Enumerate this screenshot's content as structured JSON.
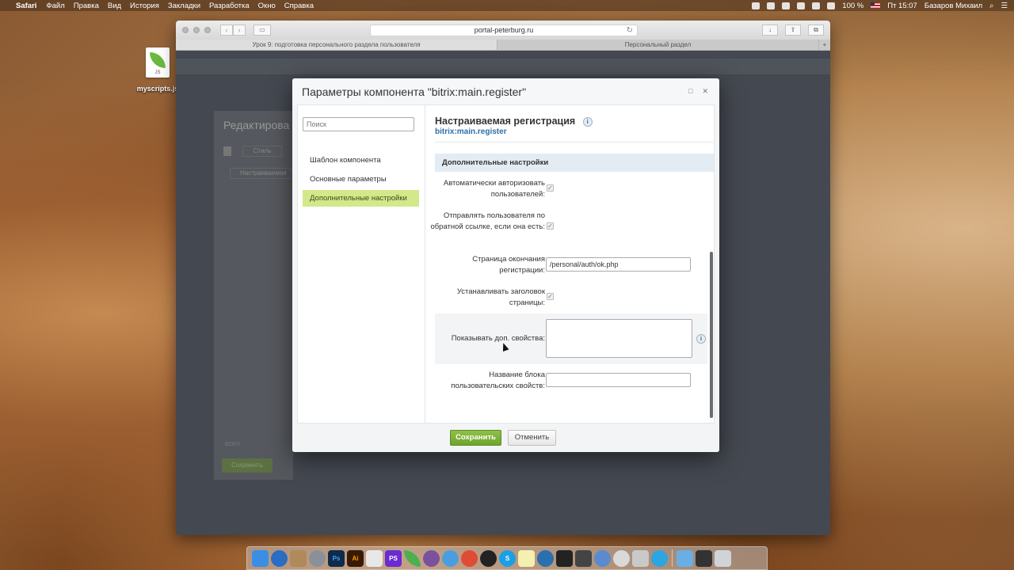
{
  "menubar": {
    "apple": "",
    "app": "Safari",
    "items": [
      "Файл",
      "Правка",
      "Вид",
      "История",
      "Закладки",
      "Разработка",
      "Окно",
      "Справка"
    ],
    "battery": "100 %",
    "clock": "Пт 15:07",
    "user": "Базаров Михаил"
  },
  "desktop": {
    "file_label": "myscripts.js",
    "file_ext": "JS"
  },
  "safari": {
    "url": "portal-peterburg.ru",
    "tabs": [
      "Урок 9: подготовка персонального раздела пользователя",
      "Персональный раздел"
    ],
    "new_tab": "+"
  },
  "background_editor": {
    "title": "Редактирова",
    "style_button": "Стиль",
    "tab": "Настраиваемая",
    "body_label": "BODY",
    "save": "Сохранить"
  },
  "modal": {
    "title": "Параметры компонента \"bitrix:main.register\"",
    "search_placeholder": "Поиск",
    "nav": [
      "Шаблон компонента",
      "Основные параметры",
      "Дополнительные настройки"
    ],
    "active_nav": 2,
    "component_name": "Настраиваемая регистрация",
    "component_code": "bitrix:main.register",
    "section": "Дополнительные настройки",
    "params": {
      "auto_auth": {
        "label": "Автоматически авторизовать пользователей:",
        "checked": true
      },
      "send_user": {
        "label": "Отправлять пользователя по обратной ссылке, если она есть:",
        "checked": true
      },
      "success_page": {
        "label": "Страница окончания регистрации:",
        "value": "/personal/auth/ok.php"
      },
      "set_title": {
        "label": "Устанавливать заголовок страницы:",
        "checked": true
      },
      "show_props": {
        "label": "Показывать доп. свойства:",
        "value": ""
      },
      "props_block_name": {
        "label": "Название блока пользовательских свойств:",
        "value": ""
      }
    },
    "save_label": "Сохранить",
    "cancel_label": "Отменить"
  }
}
